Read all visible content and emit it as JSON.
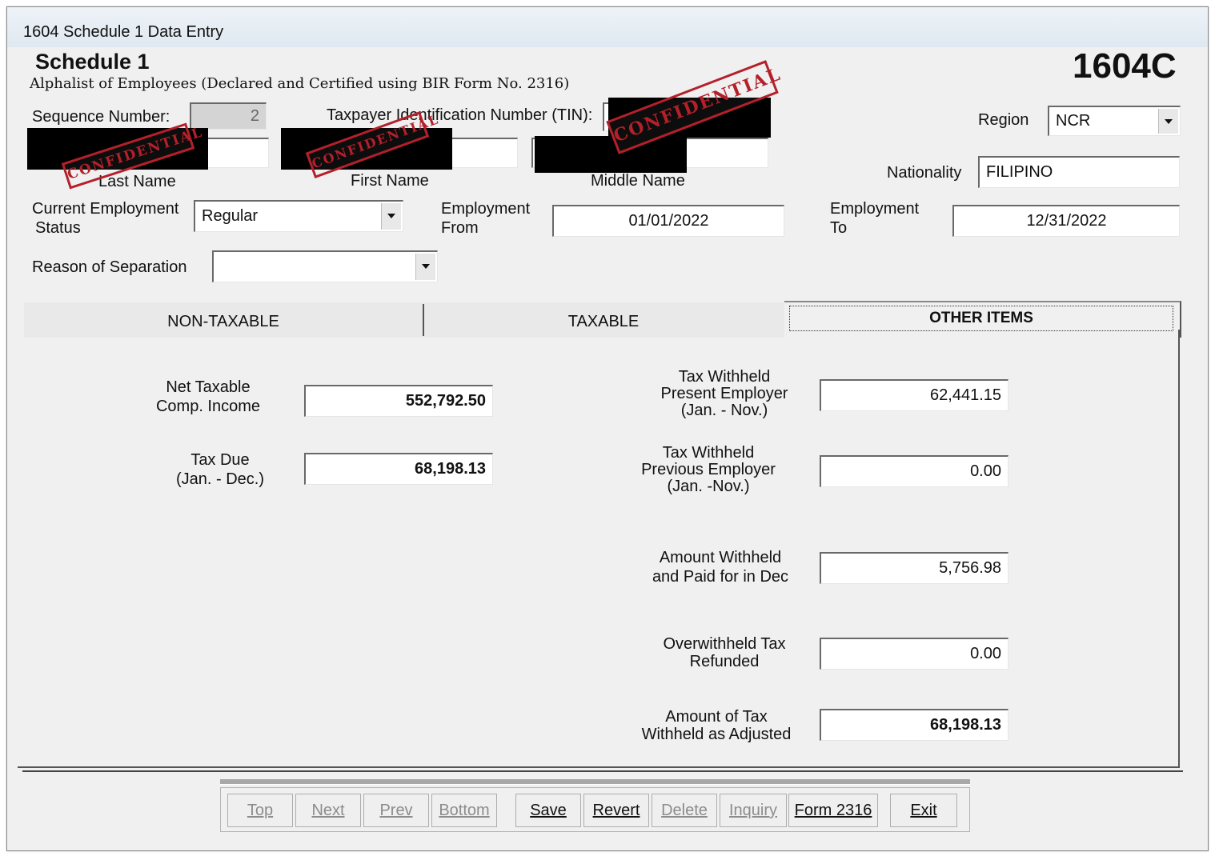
{
  "window": {
    "title": "1604 Schedule 1 Data Entry"
  },
  "header": {
    "heading": "Schedule  1",
    "subheading": "Alphalist of Employees (Declared and Certified using BIR Form No. 2316)",
    "form_code": "1604C"
  },
  "stamp": {
    "text": "CONFIDENTIAL",
    "color": "#b4202a"
  },
  "fields": {
    "sequence_label": "Sequence Number:",
    "sequence_value": "2",
    "tin_label": "Taxpayer Identification Number (TIN):",
    "region_label": "Region",
    "region_value": "NCR",
    "nationality_label": "Nationality",
    "nationality_value": "FILIPINO",
    "last_name_label": "Last Name",
    "first_name_label": "First Name",
    "middle_name_label": "Middle Name",
    "employment_status_label_1": "Current Employment",
    "employment_status_label_2": "Status",
    "employment_status_value": "Regular",
    "employment_from_label_1": "Employment",
    "employment_from_label_2": "From",
    "employment_from_value": "01/01/2022",
    "employment_to_label_1": "Employment",
    "employment_to_label_2": "To",
    "employment_to_value": "12/31/2022",
    "separation_label": "Reason of Separation",
    "separation_value": ""
  },
  "tabs": [
    {
      "label": "NON-TAXABLE",
      "active": false
    },
    {
      "label": "TAXABLE",
      "active": false
    },
    {
      "label": "OTHER ITEMS",
      "active": true
    }
  ],
  "other_items": {
    "net_taxable_label_1": "Net Taxable",
    "net_taxable_label_2": "Comp. Income",
    "net_taxable_value": "552,792.50",
    "tax_due_label_1": "Tax Due",
    "tax_due_label_2": "(Jan. - Dec.)",
    "tax_due_value": "68,198.13",
    "tw_present_label_1": "Tax Withheld",
    "tw_present_label_2": "Present Employer",
    "tw_present_label_3": "(Jan. - Nov.)",
    "tw_present_value": "62,441.15",
    "tw_previous_label_1": "Tax Withheld",
    "tw_previous_label_2": "Previous Employer",
    "tw_previous_label_3": "(Jan. -Nov.)",
    "tw_previous_value": "0.00",
    "amount_dec_label_1": "Amount Withheld",
    "amount_dec_label_2": "and Paid for in Dec",
    "amount_dec_value": "5,756.98",
    "overwithheld_label_1": "Overwithheld  Tax",
    "overwithheld_label_2": "Refunded",
    "overwithheld_value": "0.00",
    "adjusted_label_1": "Amount  of Tax",
    "adjusted_label_2": "Withheld as Adjusted",
    "adjusted_value": "68,198.13"
  },
  "buttons": [
    {
      "label": "Top",
      "enabled": false
    },
    {
      "label": "Next",
      "enabled": false
    },
    {
      "label": "Prev",
      "enabled": false
    },
    {
      "label": "Bottom",
      "enabled": false
    },
    {
      "label": "Save",
      "enabled": true
    },
    {
      "label": "Revert",
      "enabled": true
    },
    {
      "label": "Delete",
      "enabled": false
    },
    {
      "label": "Inquiry",
      "enabled": false
    },
    {
      "label": "Form 2316",
      "enabled": true
    },
    {
      "label": "Exit",
      "enabled": true
    }
  ]
}
